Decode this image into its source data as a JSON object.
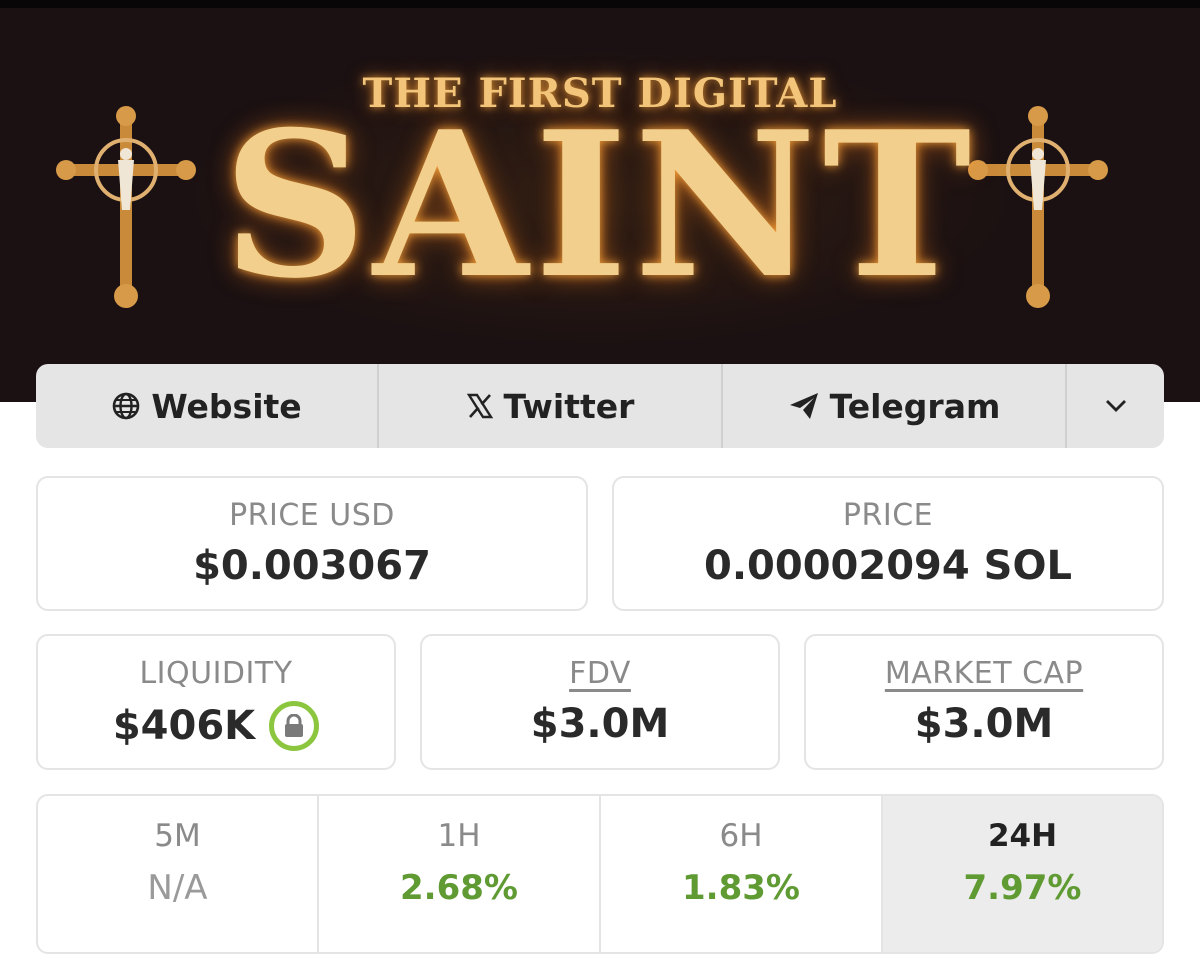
{
  "banner": {
    "subtitle": "THE FIRST DIGITAL",
    "title": "SAINT"
  },
  "links": {
    "website": {
      "label": "Website",
      "icon": "globe-icon"
    },
    "twitter": {
      "label": "Twitter",
      "icon": "x-logo-icon"
    },
    "telegram": {
      "label": "Telegram",
      "icon": "telegram-icon"
    },
    "more": {
      "icon": "chevron-down-icon"
    }
  },
  "stats": {
    "price_usd": {
      "label": "PRICE USD",
      "value": "$0.003067"
    },
    "price": {
      "label": "PRICE",
      "value": "0.00002094 SOL"
    },
    "liquidity": {
      "label": "LIQUIDITY",
      "value": "$406K",
      "icon": "lock-icon"
    },
    "fdv": {
      "label": "FDV",
      "value": "$3.0M"
    },
    "market_cap": {
      "label": "MARKET CAP",
      "value": "$3.0M"
    }
  },
  "changes": [
    {
      "label": "5M",
      "value": "N/A"
    },
    {
      "label": "1H",
      "value": "2.68%"
    },
    {
      "label": "6H",
      "value": "1.83%"
    },
    {
      "label": "24H",
      "value": "7.97%",
      "selected": true
    }
  ],
  "colors": {
    "positive": "#5f9a33",
    "lock_ring": "#8cc63f",
    "banner_gold": "#f3cf8d",
    "banner_bg": "#1b1112"
  }
}
